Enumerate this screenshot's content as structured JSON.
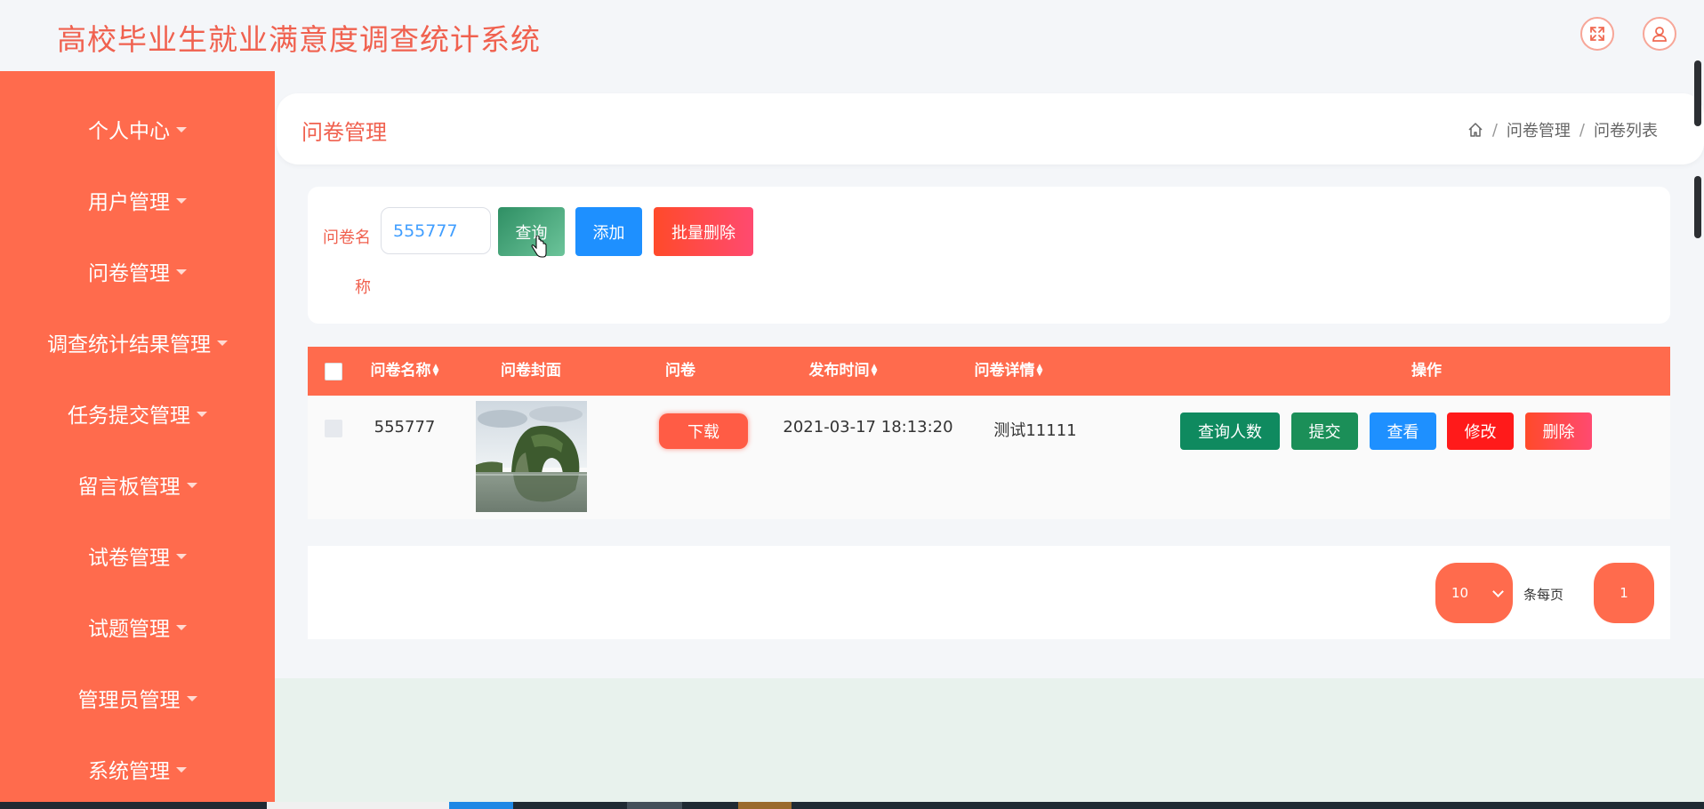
{
  "app": {
    "title": "高校毕业生就业满意度调查统计系统"
  },
  "top_icons": [
    "fullscreen-icon",
    "user-icon"
  ],
  "sidebar": {
    "items": [
      {
        "label": "个人中心"
      },
      {
        "label": "用户管理"
      },
      {
        "label": "问卷管理"
      },
      {
        "label": "调查统计结果管理"
      },
      {
        "label": "任务提交管理"
      },
      {
        "label": "留言板管理"
      },
      {
        "label": "试卷管理"
      },
      {
        "label": "试题管理"
      },
      {
        "label": "管理员管理"
      },
      {
        "label": "系统管理"
      }
    ]
  },
  "header": {
    "title": "问卷管理",
    "breadcrumb": [
      "问卷管理",
      "问卷列表"
    ]
  },
  "search": {
    "label": "问卷名称",
    "value": "555777",
    "query_label": "查询",
    "add_label": "添加",
    "batch_delete_label": "批量删除"
  },
  "table": {
    "columns": [
      "问卷名称",
      "问卷封面",
      "问卷",
      "发布时间",
      "问卷详情",
      "操作"
    ],
    "rows": [
      {
        "name": "555777",
        "questionnaire_label": "下载",
        "publish_time": "2021-03-17 18:13:20",
        "detail": "测试11111",
        "actions": [
          "查询人数",
          "提交",
          "查看",
          "修改",
          "删除"
        ]
      }
    ]
  },
  "pager": {
    "page_size": "10",
    "per_page_label": "条每页",
    "current_page": "1"
  },
  "colors": {
    "accent": "#ff6b4d",
    "title": "#f0614f",
    "green": "#0f8a5f",
    "blue": "#1e90ff",
    "red": "#ff1a1a"
  }
}
